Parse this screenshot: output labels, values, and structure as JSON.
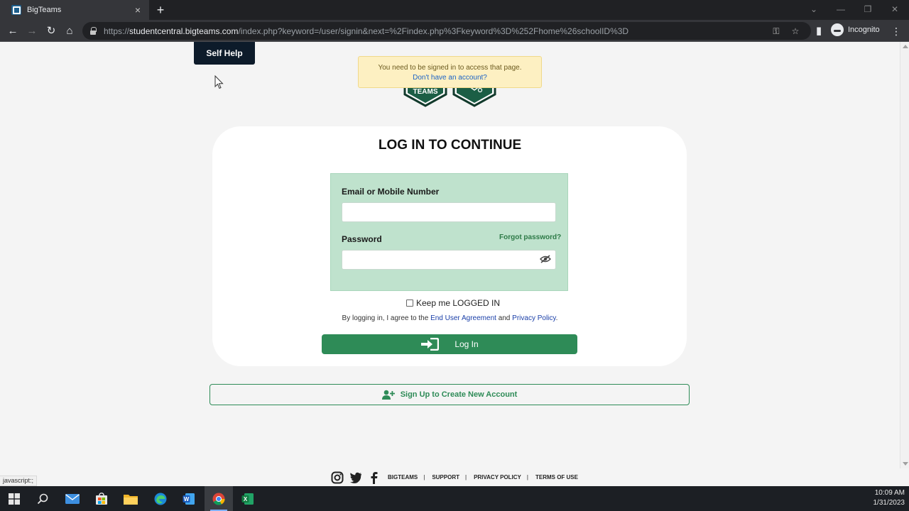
{
  "browser": {
    "tab_title": "BigTeams",
    "tab_close": "×",
    "new_tab": "+",
    "url_scheme": "https://",
    "url_host": "studentcentral.bigteams.com",
    "url_path": "/index.php?keyword=/user/signin&next=%2Findex.php%3Fkeyword%3D%252Fhome%26schoolID%3D",
    "incognito_label": "Incognito",
    "icons": [
      "back-icon",
      "forward-icon",
      "reload-icon",
      "home-icon",
      "lock-icon",
      "key-icon",
      "star-icon",
      "sidepanel-icon",
      "incognito-icon",
      "menu-icon"
    ]
  },
  "page": {
    "self_help_label": "Self Help",
    "alert": {
      "message": "You need to be signed in to access that page.",
      "link": "Don't have an account?"
    },
    "logo_text": "TEAMS",
    "title": "LOG IN TO CONTINUE",
    "form": {
      "email_label": "Email or Mobile Number",
      "email_value": "",
      "password_label": "Password",
      "password_value": "",
      "forgot_label": "Forgot password?",
      "keep_logged_in": "Keep me LOGGED IN",
      "agree_prefix": "By logging in, I agree to the",
      "agree_eula": "End User Agreement",
      "agree_and": "and",
      "agree_privacy": "Privacy Policy",
      "agree_suffix": ".",
      "login_label": "Log In"
    },
    "signup_label": "Sign Up to Create New Account",
    "footer": {
      "links": [
        "BIGTEAMS",
        "SUPPORT",
        "PRIVACY POLICY",
        "TERMS OF USE"
      ],
      "separator": "|"
    },
    "status_url": "javascript:;"
  },
  "taskbar": {
    "time": "10:09 AM",
    "date": "1/31/2023"
  },
  "colors": {
    "brand_green": "#2e8b57",
    "form_bg": "#bfe2cd",
    "alert_bg": "#fdf0c2",
    "self_help_bg": "#0d1b2a"
  }
}
